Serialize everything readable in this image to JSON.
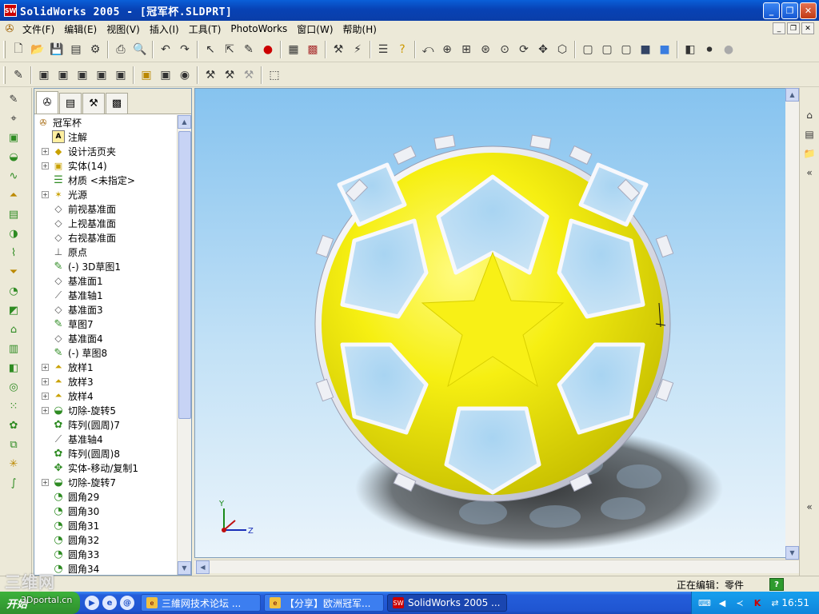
{
  "window": {
    "title": "SolidWorks 2005 - [冠军杯.SLDPRT]",
    "min_glyph": "_",
    "max_glyph": "❐",
    "close_glyph": "✕"
  },
  "menu": {
    "items": [
      "文件(F)",
      "编辑(E)",
      "视图(V)",
      "插入(I)",
      "工具(T)",
      "PhotoWorks",
      "窗口(W)",
      "帮助(H)"
    ],
    "right_buttons": [
      "_",
      "❐",
      "✕"
    ]
  },
  "feature_tree": {
    "root": "冠军杯",
    "items": [
      {
        "label": "注解",
        "icon": "annotation-icon",
        "glyph": "A",
        "expandable": false
      },
      {
        "label": "设计活页夹",
        "icon": "binder-icon",
        "glyph": "◆",
        "expandable": true
      },
      {
        "label": "实体(14)",
        "icon": "solid-bodies-icon",
        "glyph": "▣",
        "expandable": true
      },
      {
        "label": "材质 <未指定>",
        "icon": "material-icon",
        "glyph": "☰",
        "expandable": false
      },
      {
        "label": "光源",
        "icon": "lighting-icon",
        "glyph": "✶",
        "expandable": true
      },
      {
        "label": "前视基准面",
        "icon": "plane-icon",
        "glyph": "◇",
        "expandable": false
      },
      {
        "label": "上视基准面",
        "icon": "plane-icon",
        "glyph": "◇",
        "expandable": false
      },
      {
        "label": "右视基准面",
        "icon": "plane-icon",
        "glyph": "◇",
        "expandable": false
      },
      {
        "label": "原点",
        "icon": "origin-icon",
        "glyph": "⊥",
        "expandable": false
      },
      {
        "label": "(-) 3D草图1",
        "icon": "3d-sketch-icon",
        "glyph": "✎",
        "expandable": false
      },
      {
        "label": "基准面1",
        "icon": "plane-icon",
        "glyph": "◇",
        "expandable": false
      },
      {
        "label": "基准轴1",
        "icon": "axis-icon",
        "glyph": "⟋",
        "expandable": false
      },
      {
        "label": "基准面3",
        "icon": "plane-icon",
        "glyph": "◇",
        "expandable": false
      },
      {
        "label": "草图7",
        "icon": "sketch-icon",
        "glyph": "✎",
        "expandable": false
      },
      {
        "label": "基准面4",
        "icon": "plane-icon",
        "glyph": "◇",
        "expandable": false
      },
      {
        "label": "(-) 草图8",
        "icon": "sketch-icon",
        "glyph": "✎",
        "expandable": false
      },
      {
        "label": "放样1",
        "icon": "loft-icon",
        "glyph": "⏶",
        "expandable": true
      },
      {
        "label": "放样3",
        "icon": "loft-icon",
        "glyph": "⏶",
        "expandable": true
      },
      {
        "label": "放样4",
        "icon": "loft-icon",
        "glyph": "⏶",
        "expandable": true
      },
      {
        "label": "切除-旋转5",
        "icon": "revolve-cut-icon",
        "glyph": "◒",
        "expandable": true
      },
      {
        "label": "阵列(圆周)7",
        "icon": "circular-pattern-icon",
        "glyph": "✿",
        "expandable": false
      },
      {
        "label": "基准轴4",
        "icon": "axis-icon",
        "glyph": "⟋",
        "expandable": false
      },
      {
        "label": "阵列(圆周)8",
        "icon": "circular-pattern-icon",
        "glyph": "✿",
        "expandable": false
      },
      {
        "label": "实体-移动/复制1",
        "icon": "move-copy-icon",
        "glyph": "✥",
        "expandable": false
      },
      {
        "label": "切除-旋转7",
        "icon": "revolve-cut-icon",
        "glyph": "◒",
        "expandable": true
      },
      {
        "label": "圆角29",
        "icon": "fillet-icon",
        "glyph": "◔",
        "expandable": false
      },
      {
        "label": "圆角30",
        "icon": "fillet-icon",
        "glyph": "◔",
        "expandable": false
      },
      {
        "label": "圆角31",
        "icon": "fillet-icon",
        "glyph": "◔",
        "expandable": false
      },
      {
        "label": "圆角32",
        "icon": "fillet-icon",
        "glyph": "◔",
        "expandable": false
      },
      {
        "label": "圆角33",
        "icon": "fillet-icon",
        "glyph": "◔",
        "expandable": false
      },
      {
        "label": "圆角34",
        "icon": "fillet-icon",
        "glyph": "◔",
        "expandable": false
      }
    ]
  },
  "status": {
    "text": "正在编辑：零件",
    "help": "?"
  },
  "taskbar": {
    "start": "开始",
    "tasks": [
      "三維网技术论坛 ...",
      "【分享】欧洲冠军...",
      "SolidWorks 2005 ..."
    ],
    "clock": "16:51"
  },
  "watermark": {
    "text": "三维网",
    "url": "3Dportal.cn"
  },
  "viewport": {
    "triad_labels": {
      "y": "Y",
      "z": "Z"
    },
    "colors": {
      "ball_yellow": "#f6ef12",
      "ball_silver": "#e4e6ee",
      "sky_top": "#86c3ef"
    }
  }
}
